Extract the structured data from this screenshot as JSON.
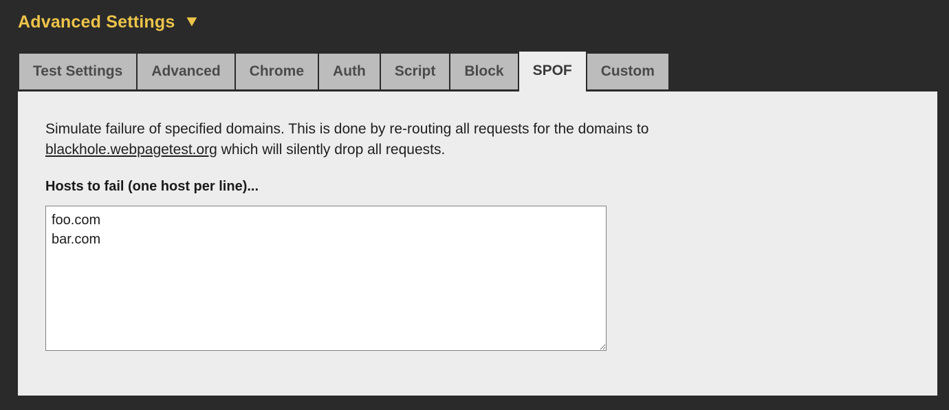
{
  "header": {
    "title": "Advanced Settings",
    "caret_icon": "triangle-down-icon",
    "caret_glyph": "▼",
    "accent_color": "#edc44a"
  },
  "tabs": [
    {
      "label": "Test Settings",
      "active": false
    },
    {
      "label": "Advanced",
      "active": false
    },
    {
      "label": "Chrome",
      "active": false
    },
    {
      "label": "Auth",
      "active": false
    },
    {
      "label": "Script",
      "active": false
    },
    {
      "label": "Block",
      "active": false
    },
    {
      "label": "SPOF",
      "active": true
    },
    {
      "label": "Custom",
      "active": false
    }
  ],
  "panel": {
    "description_part1": "Simulate failure of specified domains. This is done by re-routing all requests for the domains to ",
    "description_link": "blackhole.webpagetest.org",
    "description_part2": " which will silently drop all requests.",
    "field_label": "Hosts to fail (one host per line)...",
    "hosts_value": "foo.com\nbar.com",
    "hosts_placeholder": ""
  },
  "colors": {
    "page_background": "#2a2a2a",
    "panel_background": "#ededed",
    "tab_background": "#bcbcbc",
    "tab_active_background": "#ededed",
    "tab_text": "#4a4a4a",
    "body_text": "#202020"
  }
}
